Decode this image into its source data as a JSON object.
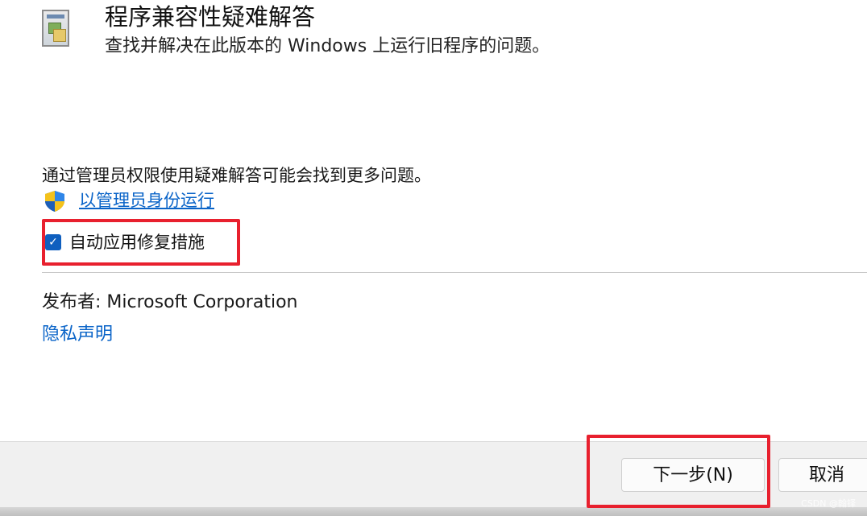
{
  "header": {
    "title": "程序兼容性疑难解答",
    "subtitle": "查找并解决在此版本的 Windows 上运行旧程序的问题。",
    "icon": "program-window-icon"
  },
  "admin": {
    "note": "通过管理员权限使用疑难解答可能会找到更多问题。",
    "link_label": "以管理员身份运行",
    "icon": "uac-shield-icon"
  },
  "auto_repair": {
    "label": "自动应用修复措施",
    "checked": true,
    "check_glyph": "✓"
  },
  "publisher": {
    "text": "发布者:  Microsoft Corporation"
  },
  "privacy": {
    "link_label": "隐私声明"
  },
  "footer": {
    "next_label": "下一步(N)",
    "cancel_label": "取消"
  },
  "watermark": "CSDN @翰铎",
  "colors": {
    "link": "#0a64c8",
    "checkbox": "#0f5fbf",
    "highlight": "#e8202e"
  }
}
